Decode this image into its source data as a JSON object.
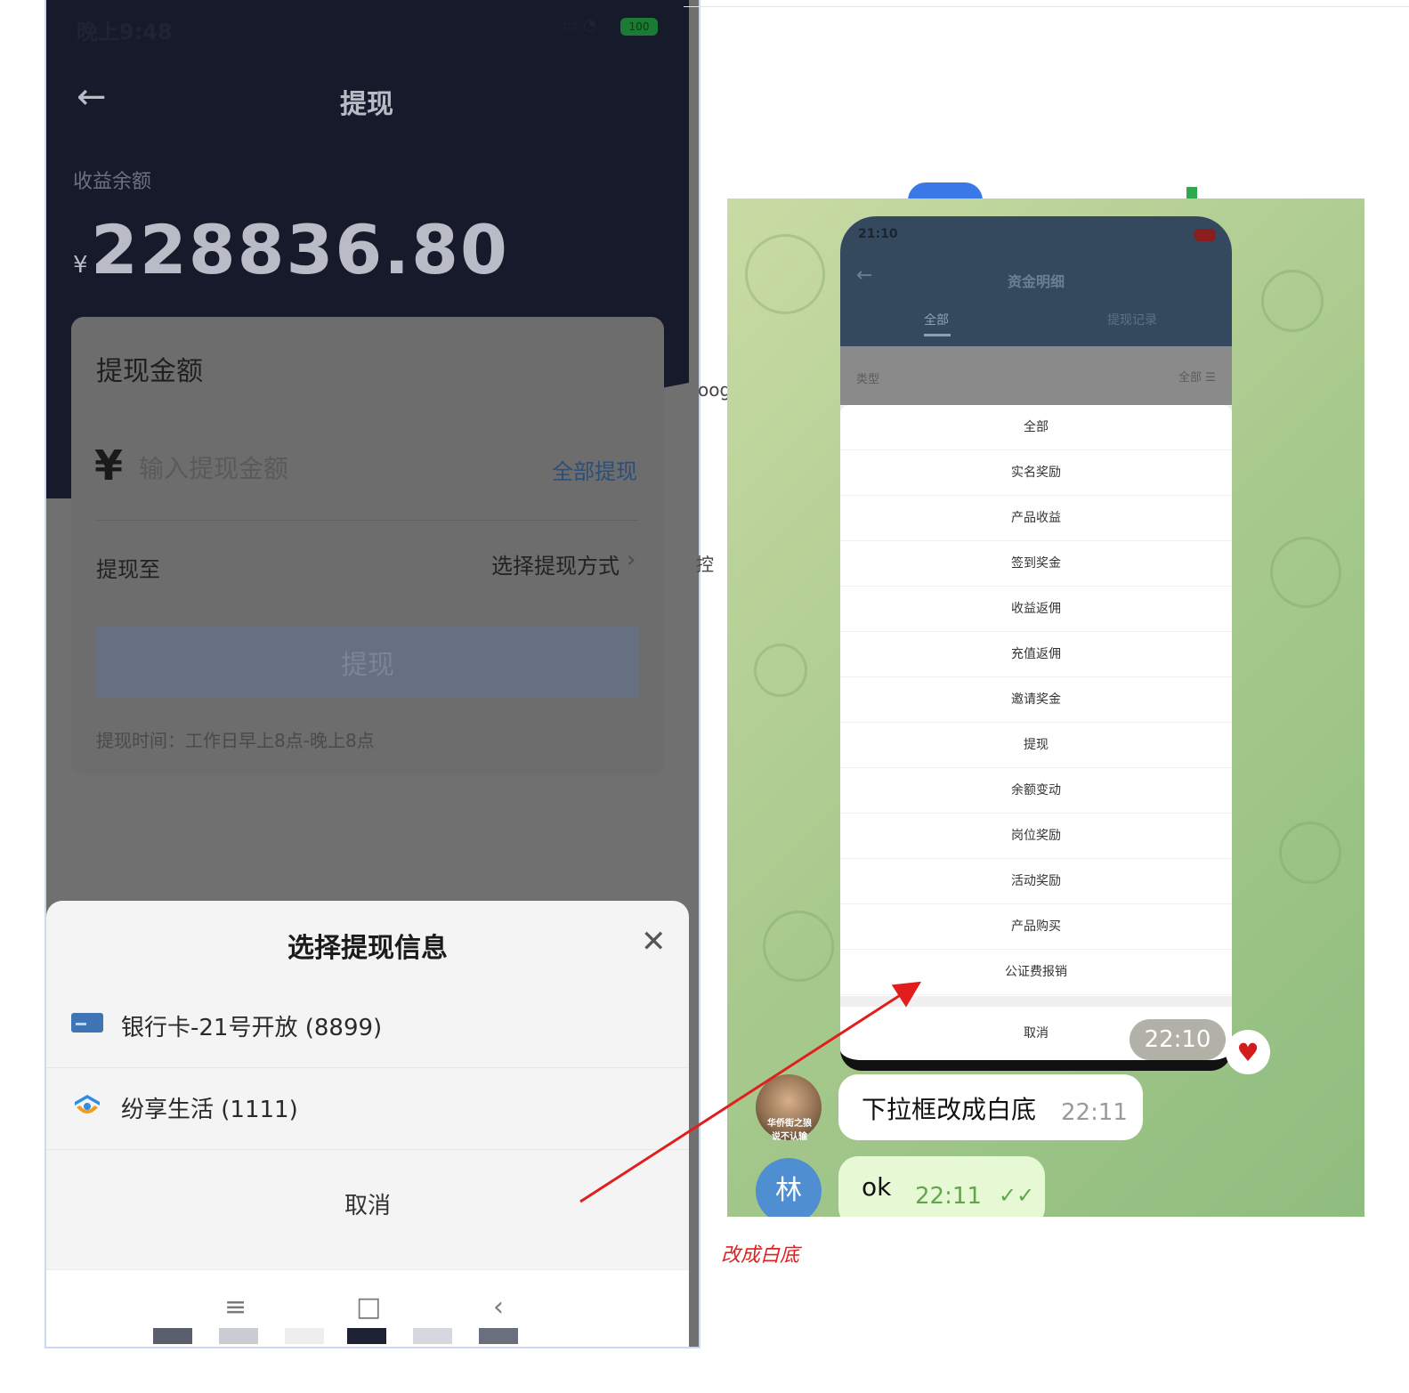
{
  "left_phone": {
    "status": {
      "time": "晚上9:48",
      "battery": "100"
    },
    "header": {
      "title": "提现"
    },
    "balance": {
      "label": "收益余额",
      "currency": "¥",
      "amount": "228836.80"
    },
    "card": {
      "title": "提现金额",
      "currency": "¥",
      "amount_placeholder": "输入提现金额",
      "all_withdraw": "全部提现",
      "to_label": "提现至",
      "method_placeholder": "选择提现方式",
      "submit_label": "提现",
      "time_note": "提现时间：工作日早上8点-晚上8点"
    },
    "sheet": {
      "title": "选择提现信息",
      "options": [
        {
          "label": "银行卡-21号开放 (8899)",
          "icon": "bank-card-icon"
        },
        {
          "label": "纷享生活 (1111)",
          "icon": "app-logo-icon"
        }
      ],
      "cancel": "取消"
    },
    "nav": {
      "menu": "≡",
      "home": "□",
      "back": "‹"
    }
  },
  "background_fragments": {
    "text_a": "oog",
    "text_b": "控"
  },
  "chat": {
    "inner_screen": {
      "status_time": "21:10",
      "title": "资金明细",
      "tabs": [
        "全部",
        "提现记录"
      ],
      "filter_label": "类型",
      "filter_value": "全部 ☰",
      "options": [
        "全部",
        "实名奖励",
        "产品收益",
        "签到奖金",
        "收益返佣",
        "充值返佣",
        "邀请奖金",
        "提现",
        "余额变动",
        "岗位奖励",
        "活动奖励",
        "产品购买",
        "公证费报销"
      ],
      "cancel": "取消"
    },
    "time_pill": "22:10",
    "messages": [
      {
        "avatar_text": "华侨街之狼 说不认输",
        "text": "下拉框改成白底",
        "time": "22:11"
      },
      {
        "avatar_text": "林",
        "text": "ok",
        "time": "22:11",
        "status": "✓✓"
      }
    ]
  },
  "annotation": {
    "text": "改成白底",
    "color": "#e21d1d"
  }
}
